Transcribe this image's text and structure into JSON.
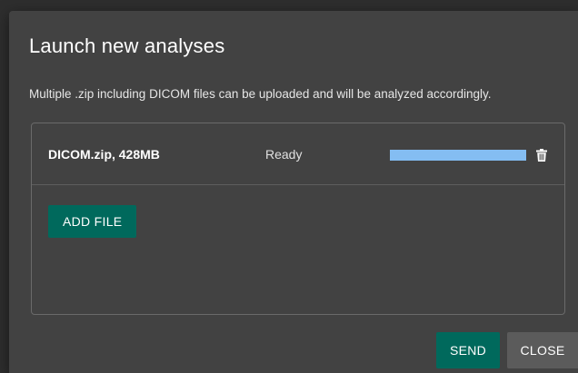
{
  "dialog": {
    "title": "Launch new analyses",
    "description": "Multiple .zip including DICOM files can be uploaded and will be analyzed accordingly."
  },
  "files": [
    {
      "name": "DICOM.zip, 428MB",
      "status": "Ready",
      "progress": 1.0,
      "delete_icon": "trash-icon"
    }
  ],
  "dropzone": {
    "add_file_label": "ADD FILE"
  },
  "actions": {
    "send_label": "SEND",
    "close_label": "CLOSE"
  },
  "colors": {
    "dialog_bg": "#424242",
    "primary_button": "#00695c",
    "secondary_button": "#5b5b5b",
    "progress_fill": "#84bdf2",
    "text": "#ffffff"
  }
}
